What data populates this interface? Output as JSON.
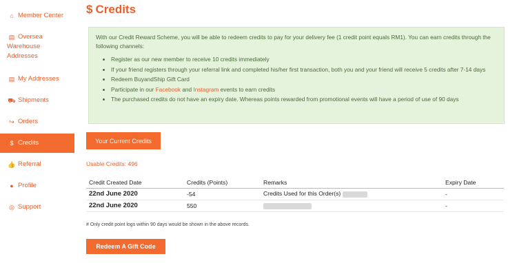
{
  "sidebar": {
    "items": [
      {
        "label": "Member Center",
        "icon": "home-icon",
        "glyph": "⌂"
      },
      {
        "label": "Oversea Warehouse Addresses",
        "line1": "Oversea",
        "line2": "Warehouse",
        "line3": "Addresses",
        "icon": "list-icon",
        "glyph": "▤"
      },
      {
        "label": "My Addresses",
        "icon": "list-icon",
        "glyph": "▤"
      },
      {
        "label": "Shipments",
        "icon": "truck-icon",
        "glyph": "⛟"
      },
      {
        "label": "Orders",
        "icon": "share-icon",
        "glyph": "↪"
      },
      {
        "label": "Credits",
        "icon": "dollar-icon",
        "glyph": "$"
      },
      {
        "label": "Referral",
        "icon": "thumbs-up-icon",
        "glyph": "👍"
      },
      {
        "label": "Profile",
        "icon": "user-icon",
        "glyph": "●"
      },
      {
        "label": "Support",
        "icon": "lifebuoy-icon",
        "glyph": "◎"
      }
    ],
    "active": "Credits"
  },
  "page": {
    "title": "Credits",
    "title_glyph": "$"
  },
  "info": {
    "intro": "With our Credit Reward Scheme, you will be able to redeem credits to pay for your delivery fee (1 credit point equals RM1). You can earn credits through the following channels:",
    "bullets": [
      "Register as our new member to receive 10 credits immediately",
      "If your friend registers through your referral link and completed his/her first transaction, both you and your friend will receive 5 credits after 7-14 days",
      "Redeem BuyandShip Gift Card"
    ],
    "participate_prefix": "Participate in our ",
    "facebook": "Facebook",
    "and": " and ",
    "instagram": "Instagram",
    "participate_suffix": " events to earn credits",
    "expiry_note": "The purchased credits do not have an expiry date. Whereas points rewarded from promotional events will have a period of use of 90 days"
  },
  "credits": {
    "current_button": "Your Current Credits",
    "usable": "Usable Credits: 496"
  },
  "table": {
    "headers": [
      "Credit Created Date",
      "Credits (Points)",
      "Remarks",
      "Expiry Date"
    ],
    "rows": [
      {
        "date": "22nd June 2020",
        "points": "-54",
        "remarks": "Credits Used for this Order(s)",
        "expiry": "-"
      },
      {
        "date": "22nd June 2020",
        "points": "550",
        "remarks": "",
        "expiry": "-"
      }
    ]
  },
  "note": "# Only credit point logs within 90 days would be shown in the above records.",
  "redeem_button": "Redeem A Gift Code",
  "colors": {
    "accent": "#f26a2e",
    "info_bg": "#e5f2dc",
    "info_text": "#4a6a3a"
  }
}
